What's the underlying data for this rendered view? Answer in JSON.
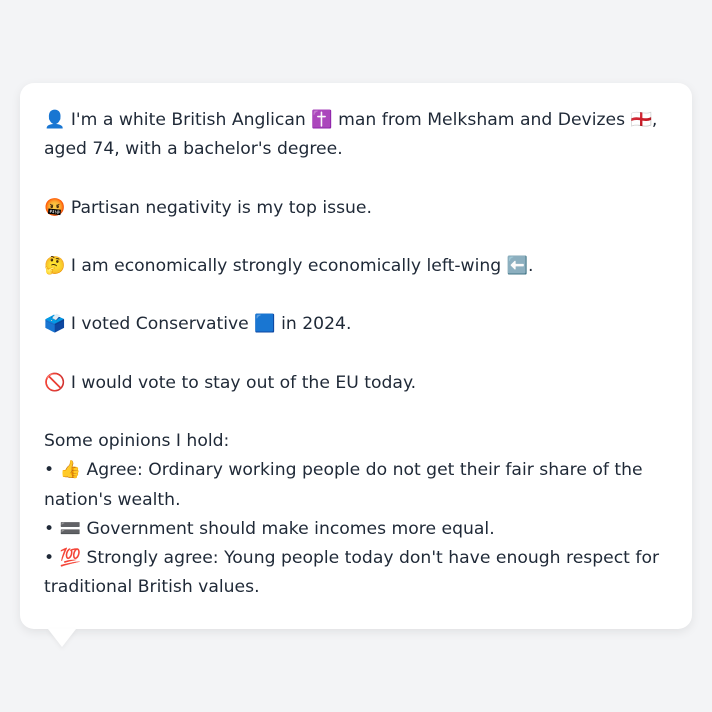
{
  "profile": {
    "identity": "👤 I'm a white British Anglican ✝️ man from Melksham and Devizes 🏴󠁧󠁢󠁥󠁮󠁧󠁿, aged 74, with a bachelor's degree.",
    "top_issue": "🤬 Partisan negativity is my top issue.",
    "economics": "🤔 I am economically strongly economically left-wing ⬅️.",
    "vote_2024": "🗳️ I voted Conservative 🟦 in 2024.",
    "eu_vote": "🚫 I would vote to stay out of the EU today."
  },
  "opinions": {
    "heading": "Some opinions I hold:",
    "items": [
      "• 👍 Agree: Ordinary working people do not get their fair share of the nation's wealth.",
      "• 🟰 Government should make incomes more equal.",
      "• 💯 Strongly agree: Young people today don't have enough respect for traditional British values."
    ]
  }
}
